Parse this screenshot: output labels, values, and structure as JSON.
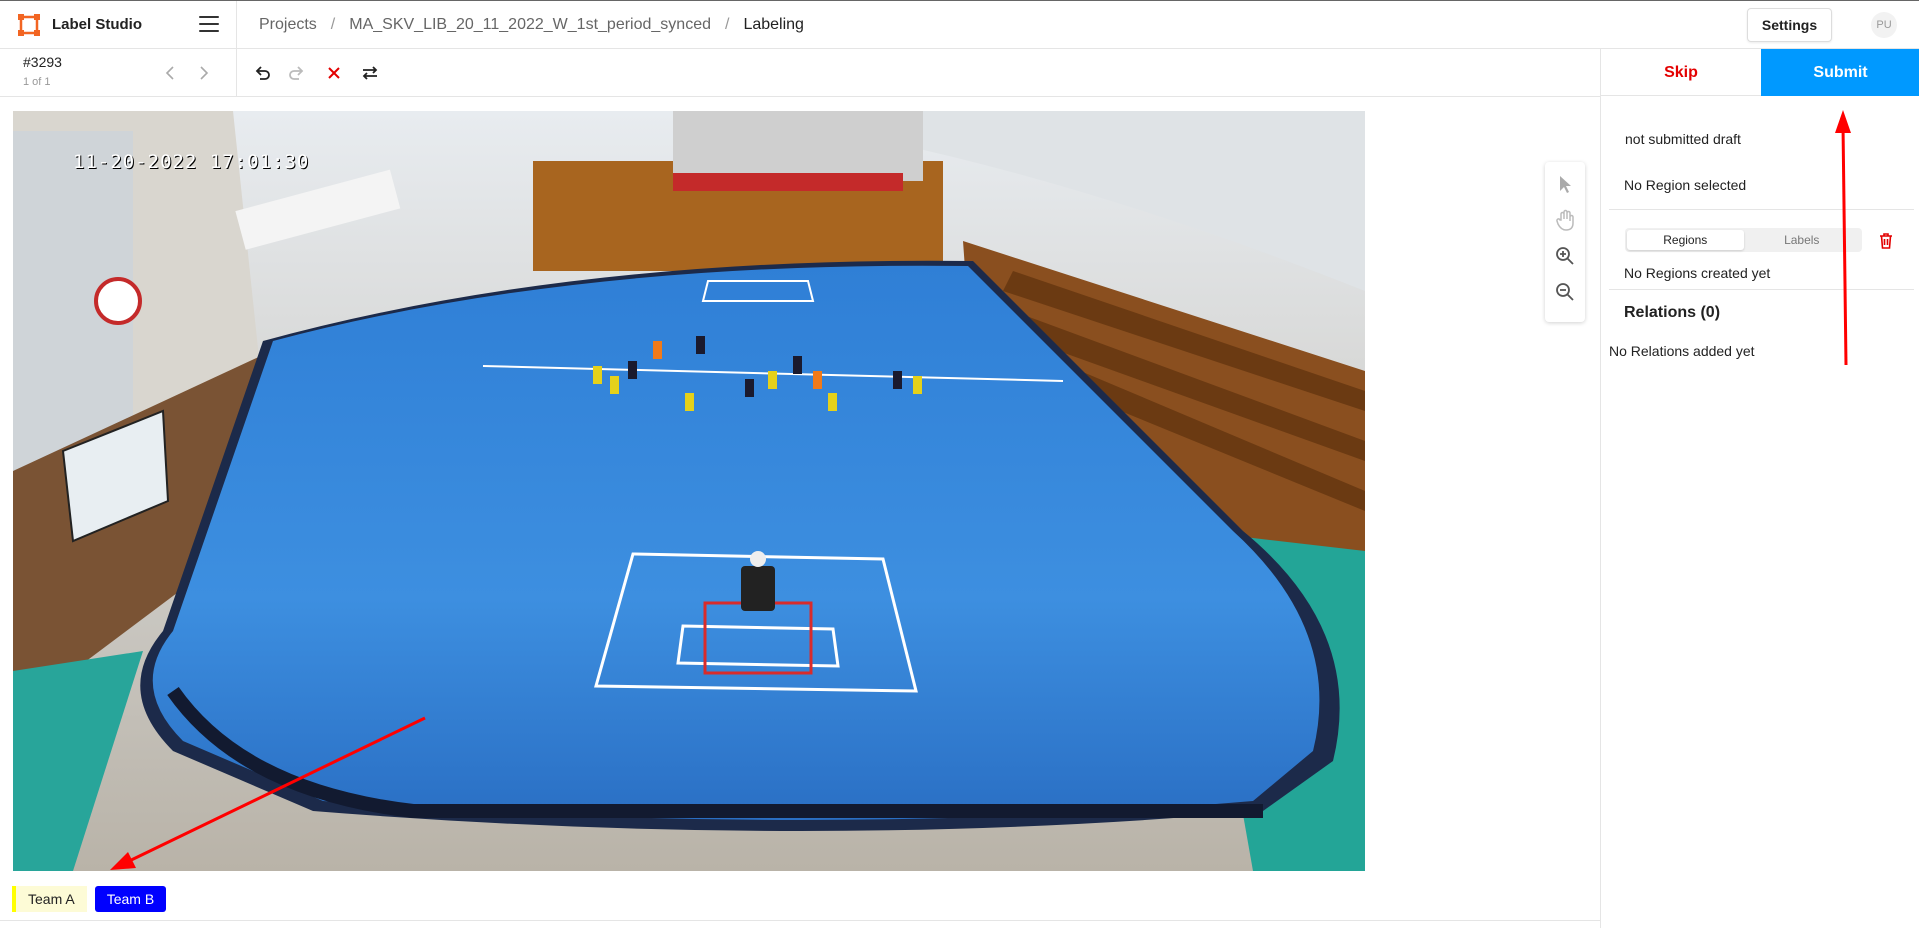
{
  "app": {
    "title": "Label Studio"
  },
  "breadcrumb": {
    "items": [
      "Projects",
      "MA_SKV_LIB_20_11_2022_W_1st_period_synced",
      "Labeling"
    ],
    "separator": "/"
  },
  "header": {
    "settings_label": "Settings",
    "avatar_initials": "PU"
  },
  "task": {
    "id": "#3293",
    "count": "1 of 1"
  },
  "image": {
    "timestamp": "11-20-2022 17:01:30"
  },
  "labels": [
    {
      "name": "Team A",
      "color": "#ffff00"
    },
    {
      "name": "Team B",
      "color": "#0000ff"
    }
  ],
  "side_panel": {
    "skip_label": "Skip",
    "submit_label": "Submit",
    "draft_status": "not submitted draft",
    "region_status": "No Region selected",
    "tabs": [
      "Regions",
      "Labels"
    ],
    "regions_empty": "No Regions created yet",
    "relations_title": "Relations (0)",
    "relations_empty": "No Relations added yet"
  },
  "colors": {
    "accent": "#0099ff",
    "danger": "#e30000",
    "annotation_arrow": "#ff0000"
  }
}
